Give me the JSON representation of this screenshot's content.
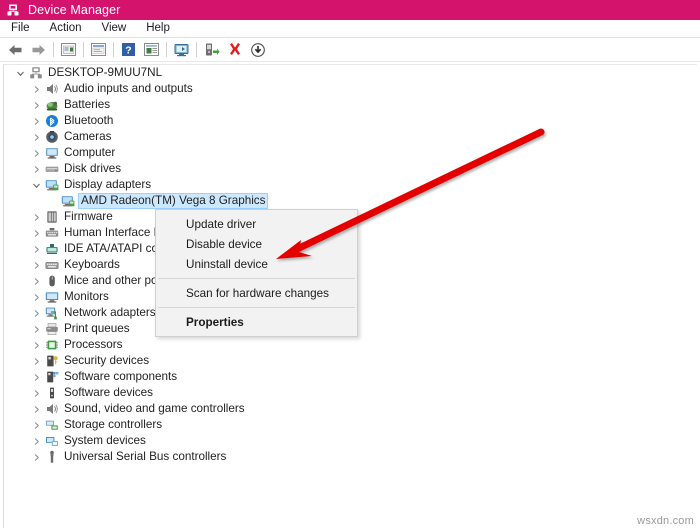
{
  "window": {
    "title": "Device Manager",
    "title_icon": "device-manager-icon",
    "titlebar_color": "#d3136c",
    "selection_color": "#cce8ff"
  },
  "menubar": {
    "items": [
      {
        "label": "File",
        "name": "menu-file"
      },
      {
        "label": "Action",
        "name": "menu-action"
      },
      {
        "label": "View",
        "name": "menu-view"
      },
      {
        "label": "Help",
        "name": "menu-help"
      }
    ]
  },
  "toolbar": {
    "buttons": [
      {
        "icon": "back-arrow-icon",
        "name": "toolbar-back"
      },
      {
        "icon": "forward-arrow-icon",
        "name": "toolbar-forward"
      },
      {
        "icon": "separator",
        "name": "toolbar-separator-1"
      },
      {
        "icon": "show-hidden-devices-icon",
        "name": "toolbar-show-hidden-devices"
      },
      {
        "icon": "separator",
        "name": "toolbar-separator-2"
      },
      {
        "icon": "properties-icon",
        "name": "toolbar-properties"
      },
      {
        "icon": "separator",
        "name": "toolbar-separator-3"
      },
      {
        "icon": "help-icon",
        "name": "toolbar-help"
      },
      {
        "icon": "device-details-icon",
        "name": "toolbar-device-details"
      },
      {
        "icon": "separator",
        "name": "toolbar-separator-4"
      },
      {
        "icon": "scan-hardware-changes-icon",
        "name": "toolbar-scan-hardware-changes"
      },
      {
        "icon": "separator",
        "name": "toolbar-separator-5"
      },
      {
        "icon": "update-driver-icon",
        "name": "toolbar-update-driver"
      },
      {
        "icon": "uninstall-device-icon",
        "name": "toolbar-uninstall-device"
      },
      {
        "icon": "disable-device-icon",
        "name": "toolbar-disable-device"
      }
    ]
  },
  "tree": {
    "root": {
      "label": "DESKTOP-9MUU7NL",
      "icon": "computer-root-icon",
      "expanded": true
    },
    "nodes": [
      {
        "label": "Audio inputs and outputs",
        "icon": "speaker-icon",
        "expanded": false,
        "selected": false,
        "indent": 1
      },
      {
        "label": "Batteries",
        "icon": "battery-icon",
        "expanded": false,
        "selected": false,
        "indent": 1
      },
      {
        "label": "Bluetooth",
        "icon": "bluetooth-icon",
        "expanded": false,
        "selected": false,
        "indent": 1
      },
      {
        "label": "Cameras",
        "icon": "camera-icon",
        "expanded": false,
        "selected": false,
        "indent": 1
      },
      {
        "label": "Computer",
        "icon": "computer-icon",
        "expanded": false,
        "selected": false,
        "indent": 1
      },
      {
        "label": "Disk drives",
        "icon": "disk-drive-icon",
        "expanded": false,
        "selected": false,
        "indent": 1
      },
      {
        "label": "Display adapters",
        "icon": "display-adapter-icon",
        "expanded": true,
        "selected": false,
        "indent": 1
      },
      {
        "label": "AMD Radeon(TM) Vega 8 Graphics",
        "icon": "display-adapter-icon",
        "expanded": null,
        "selected": true,
        "indent": 2
      },
      {
        "label": "Firmware",
        "icon": "firmware-icon",
        "expanded": false,
        "selected": false,
        "indent": 1
      },
      {
        "label": "Human Interface Devices",
        "icon": "hid-icon",
        "expanded": false,
        "selected": false,
        "indent": 1
      },
      {
        "label": "IDE ATA/ATAPI controllers",
        "icon": "ide-controller-icon",
        "expanded": false,
        "selected": false,
        "indent": 1
      },
      {
        "label": "Keyboards",
        "icon": "keyboard-icon",
        "expanded": false,
        "selected": false,
        "indent": 1
      },
      {
        "label": "Mice and other pointing devices",
        "icon": "mouse-icon",
        "expanded": false,
        "selected": false,
        "indent": 1
      },
      {
        "label": "Monitors",
        "icon": "monitor-icon",
        "expanded": false,
        "selected": false,
        "indent": 1
      },
      {
        "label": "Network adapters",
        "icon": "network-adapter-icon",
        "expanded": false,
        "selected": false,
        "indent": 1
      },
      {
        "label": "Print queues",
        "icon": "printer-icon",
        "expanded": false,
        "selected": false,
        "indent": 1
      },
      {
        "label": "Processors",
        "icon": "processor-icon",
        "expanded": false,
        "selected": false,
        "indent": 1
      },
      {
        "label": "Security devices",
        "icon": "security-device-icon",
        "expanded": false,
        "selected": false,
        "indent": 1
      },
      {
        "label": "Software components",
        "icon": "software-component-icon",
        "expanded": false,
        "selected": false,
        "indent": 1
      },
      {
        "label": "Software devices",
        "icon": "software-device-icon",
        "expanded": false,
        "selected": false,
        "indent": 1
      },
      {
        "label": "Sound, video and game controllers",
        "icon": "sound-controller-icon",
        "expanded": false,
        "selected": false,
        "indent": 1
      },
      {
        "label": "Storage controllers",
        "icon": "storage-controller-icon",
        "expanded": false,
        "selected": false,
        "indent": 1
      },
      {
        "label": "System devices",
        "icon": "system-device-icon",
        "expanded": false,
        "selected": false,
        "indent": 1
      },
      {
        "label": "Universal Serial Bus controllers",
        "icon": "usb-controller-icon",
        "expanded": false,
        "selected": false,
        "indent": 1
      }
    ]
  },
  "context_menu": {
    "items": [
      {
        "label": "Update driver",
        "type": "item",
        "bold": false,
        "name": "ctx-update-driver"
      },
      {
        "label": "Disable device",
        "type": "item",
        "bold": false,
        "name": "ctx-disable-device"
      },
      {
        "label": "Uninstall device",
        "type": "item",
        "bold": false,
        "name": "ctx-uninstall-device"
      },
      {
        "label": "",
        "type": "separator",
        "bold": false,
        "name": "ctx-separator-1"
      },
      {
        "label": "Scan for hardware changes",
        "type": "item",
        "bold": false,
        "name": "ctx-scan-for-hardware-changes"
      },
      {
        "label": "",
        "type": "separator",
        "bold": false,
        "name": "ctx-separator-2"
      },
      {
        "label": "Properties",
        "type": "item",
        "bold": true,
        "name": "ctx-properties"
      }
    ]
  },
  "annotation": {
    "arrow_color": "#e50000",
    "arrow_points_to": "Uninstall device"
  },
  "watermark": {
    "text": "wsxdn.com"
  }
}
